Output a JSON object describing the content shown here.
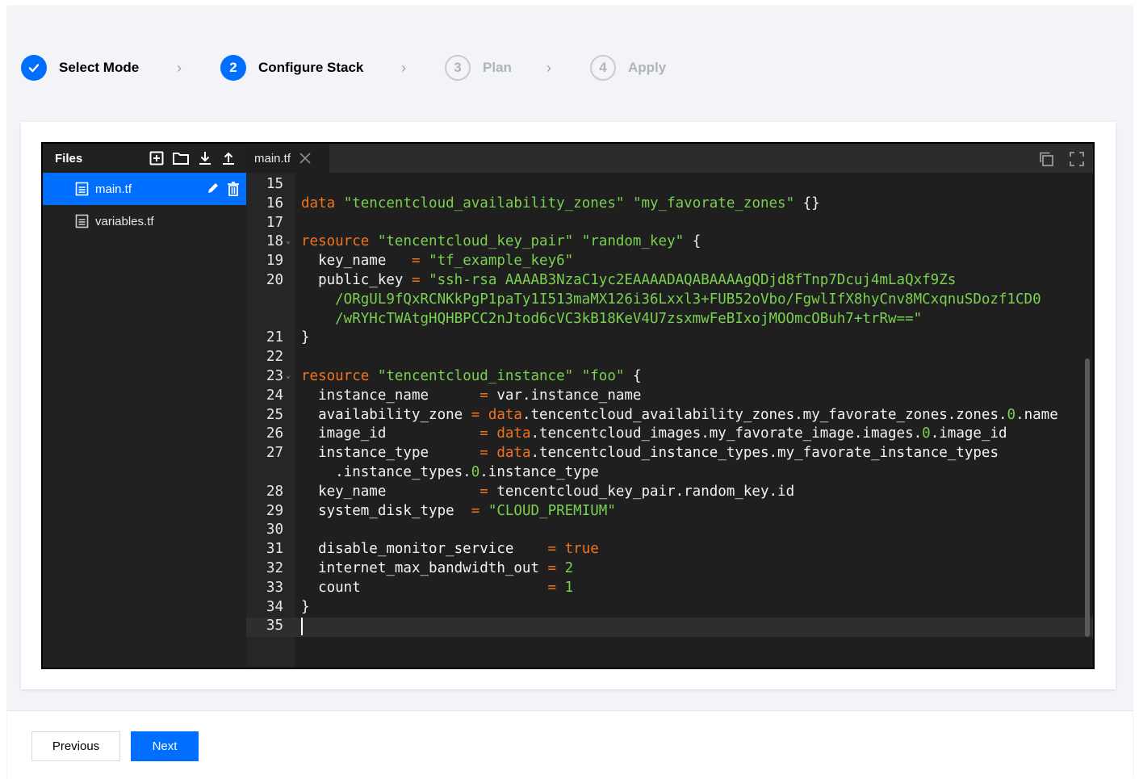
{
  "steps": [
    {
      "label": "Select Mode",
      "status": "done",
      "number": ""
    },
    {
      "label": "Configure Stack",
      "status": "active",
      "number": "2"
    },
    {
      "label": "Plan",
      "status": "pending",
      "number": "3"
    },
    {
      "label": "Apply",
      "status": "pending",
      "number": "4"
    }
  ],
  "files": {
    "title": "Files",
    "items": [
      {
        "name": "main.tf",
        "selected": true
      },
      {
        "name": "variables.tf",
        "selected": false
      }
    ]
  },
  "tabs": [
    {
      "label": "main.tf"
    }
  ],
  "code": {
    "line_numbers": [
      "15",
      "16",
      "17",
      "18",
      "19",
      "20",
      "21",
      "22",
      "23",
      "24",
      "25",
      "26",
      "27",
      "28",
      "29",
      "30",
      "31",
      "32",
      "33",
      "34",
      "35"
    ]
  },
  "footer": {
    "previous_label": "Previous",
    "next_label": "Next"
  },
  "colors": {
    "accent": "#006eff",
    "keyword": "#f2731f",
    "string": "#7ad04f"
  }
}
